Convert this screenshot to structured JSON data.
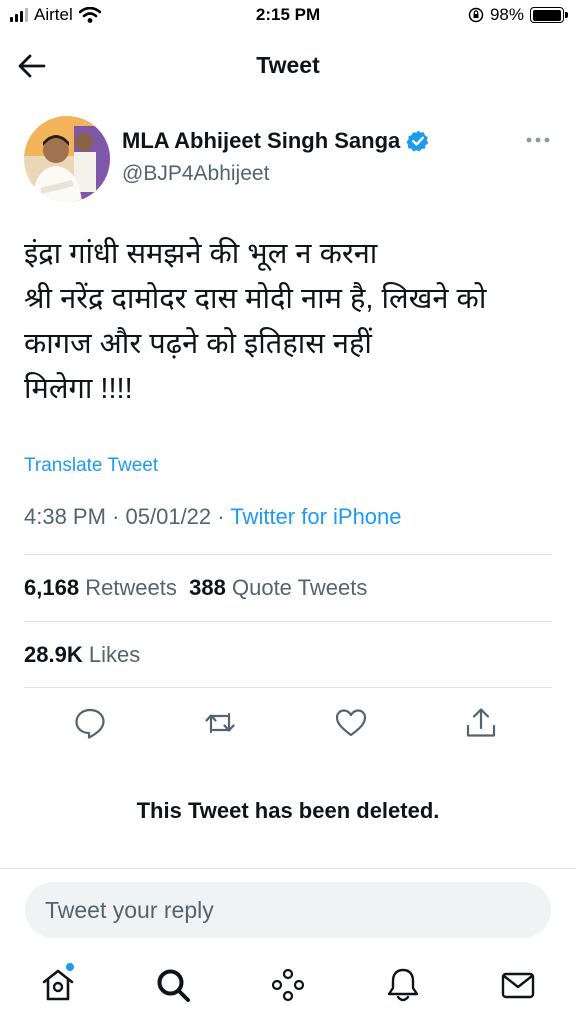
{
  "status_bar": {
    "carrier": "Airtel",
    "time": "2:15 PM",
    "battery": "98%",
    "battery_level": 0.98
  },
  "nav": {
    "title": "Tweet",
    "back_icon": "arrow-left-icon"
  },
  "author": {
    "name": "MLA Abhijeet Singh Sanga",
    "handle": "@BJP4Abhijeet",
    "verified": true
  },
  "tweet": {
    "lines": [
      "इंद्रा गांधी समझने की भूल न करना",
      "श्री नरेंद्र दामोदर दास मोदी नाम है, लिखने को",
      "कागज और पढ़ने को इतिहास नहीं",
      "मिलेगा !!!!"
    ],
    "translate_label": "Translate Tweet",
    "time": "4:38 PM",
    "date": "05/01/22",
    "separator": "·",
    "source": "Twitter for iPhone"
  },
  "stats": {
    "retweets_count": "6,168",
    "retweets_label": "Retweets",
    "quotes_count": "388",
    "quotes_label": "Quote Tweets",
    "likes_count": "28.9K",
    "likes_label": "Likes"
  },
  "actions": [
    "reply-icon",
    "retweet-icon",
    "like-icon",
    "share-icon"
  ],
  "deleted_notice": "This Tweet has been deleted.",
  "reply": {
    "placeholder": "Tweet your reply"
  },
  "tab_bar": [
    "home-icon",
    "search-icon",
    "spaces-icon",
    "notifications-icon",
    "messages-icon"
  ],
  "colors": {
    "accent": "#1d9bf0",
    "text": "#0f1419",
    "secondary": "#536471"
  }
}
